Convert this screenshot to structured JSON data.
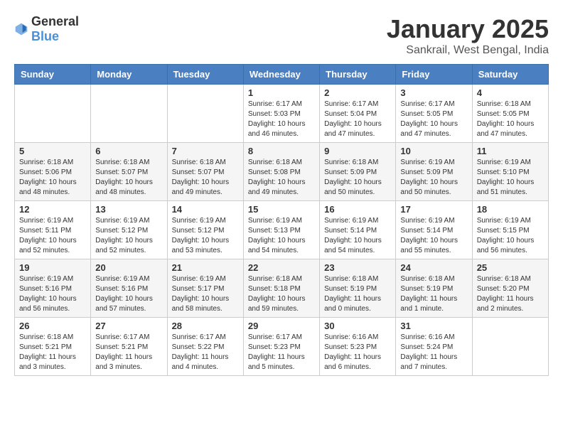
{
  "header": {
    "logo_general": "General",
    "logo_blue": "Blue",
    "title": "January 2025",
    "subtitle": "Sankrail, West Bengal, India"
  },
  "days_of_week": [
    "Sunday",
    "Monday",
    "Tuesday",
    "Wednesday",
    "Thursday",
    "Friday",
    "Saturday"
  ],
  "weeks": [
    [
      {
        "day": "",
        "info": ""
      },
      {
        "day": "",
        "info": ""
      },
      {
        "day": "",
        "info": ""
      },
      {
        "day": "1",
        "info": "Sunrise: 6:17 AM\nSunset: 5:03 PM\nDaylight: 10 hours\nand 46 minutes."
      },
      {
        "day": "2",
        "info": "Sunrise: 6:17 AM\nSunset: 5:04 PM\nDaylight: 10 hours\nand 47 minutes."
      },
      {
        "day": "3",
        "info": "Sunrise: 6:17 AM\nSunset: 5:05 PM\nDaylight: 10 hours\nand 47 minutes."
      },
      {
        "day": "4",
        "info": "Sunrise: 6:18 AM\nSunset: 5:05 PM\nDaylight: 10 hours\nand 47 minutes."
      }
    ],
    [
      {
        "day": "5",
        "info": "Sunrise: 6:18 AM\nSunset: 5:06 PM\nDaylight: 10 hours\nand 48 minutes."
      },
      {
        "day": "6",
        "info": "Sunrise: 6:18 AM\nSunset: 5:07 PM\nDaylight: 10 hours\nand 48 minutes."
      },
      {
        "day": "7",
        "info": "Sunrise: 6:18 AM\nSunset: 5:07 PM\nDaylight: 10 hours\nand 49 minutes."
      },
      {
        "day": "8",
        "info": "Sunrise: 6:18 AM\nSunset: 5:08 PM\nDaylight: 10 hours\nand 49 minutes."
      },
      {
        "day": "9",
        "info": "Sunrise: 6:18 AM\nSunset: 5:09 PM\nDaylight: 10 hours\nand 50 minutes."
      },
      {
        "day": "10",
        "info": "Sunrise: 6:19 AM\nSunset: 5:09 PM\nDaylight: 10 hours\nand 50 minutes."
      },
      {
        "day": "11",
        "info": "Sunrise: 6:19 AM\nSunset: 5:10 PM\nDaylight: 10 hours\nand 51 minutes."
      }
    ],
    [
      {
        "day": "12",
        "info": "Sunrise: 6:19 AM\nSunset: 5:11 PM\nDaylight: 10 hours\nand 52 minutes."
      },
      {
        "day": "13",
        "info": "Sunrise: 6:19 AM\nSunset: 5:12 PM\nDaylight: 10 hours\nand 52 minutes."
      },
      {
        "day": "14",
        "info": "Sunrise: 6:19 AM\nSunset: 5:12 PM\nDaylight: 10 hours\nand 53 minutes."
      },
      {
        "day": "15",
        "info": "Sunrise: 6:19 AM\nSunset: 5:13 PM\nDaylight: 10 hours\nand 54 minutes."
      },
      {
        "day": "16",
        "info": "Sunrise: 6:19 AM\nSunset: 5:14 PM\nDaylight: 10 hours\nand 54 minutes."
      },
      {
        "day": "17",
        "info": "Sunrise: 6:19 AM\nSunset: 5:14 PM\nDaylight: 10 hours\nand 55 minutes."
      },
      {
        "day": "18",
        "info": "Sunrise: 6:19 AM\nSunset: 5:15 PM\nDaylight: 10 hours\nand 56 minutes."
      }
    ],
    [
      {
        "day": "19",
        "info": "Sunrise: 6:19 AM\nSunset: 5:16 PM\nDaylight: 10 hours\nand 56 minutes."
      },
      {
        "day": "20",
        "info": "Sunrise: 6:19 AM\nSunset: 5:16 PM\nDaylight: 10 hours\nand 57 minutes."
      },
      {
        "day": "21",
        "info": "Sunrise: 6:19 AM\nSunset: 5:17 PM\nDaylight: 10 hours\nand 58 minutes."
      },
      {
        "day": "22",
        "info": "Sunrise: 6:18 AM\nSunset: 5:18 PM\nDaylight: 10 hours\nand 59 minutes."
      },
      {
        "day": "23",
        "info": "Sunrise: 6:18 AM\nSunset: 5:19 PM\nDaylight: 11 hours\nand 0 minutes."
      },
      {
        "day": "24",
        "info": "Sunrise: 6:18 AM\nSunset: 5:19 PM\nDaylight: 11 hours\nand 1 minute."
      },
      {
        "day": "25",
        "info": "Sunrise: 6:18 AM\nSunset: 5:20 PM\nDaylight: 11 hours\nand 2 minutes."
      }
    ],
    [
      {
        "day": "26",
        "info": "Sunrise: 6:18 AM\nSunset: 5:21 PM\nDaylight: 11 hours\nand 3 minutes."
      },
      {
        "day": "27",
        "info": "Sunrise: 6:17 AM\nSunset: 5:21 PM\nDaylight: 11 hours\nand 3 minutes."
      },
      {
        "day": "28",
        "info": "Sunrise: 6:17 AM\nSunset: 5:22 PM\nDaylight: 11 hours\nand 4 minutes."
      },
      {
        "day": "29",
        "info": "Sunrise: 6:17 AM\nSunset: 5:23 PM\nDaylight: 11 hours\nand 5 minutes."
      },
      {
        "day": "30",
        "info": "Sunrise: 6:16 AM\nSunset: 5:23 PM\nDaylight: 11 hours\nand 6 minutes."
      },
      {
        "day": "31",
        "info": "Sunrise: 6:16 AM\nSunset: 5:24 PM\nDaylight: 11 hours\nand 7 minutes."
      },
      {
        "day": "",
        "info": ""
      }
    ]
  ]
}
